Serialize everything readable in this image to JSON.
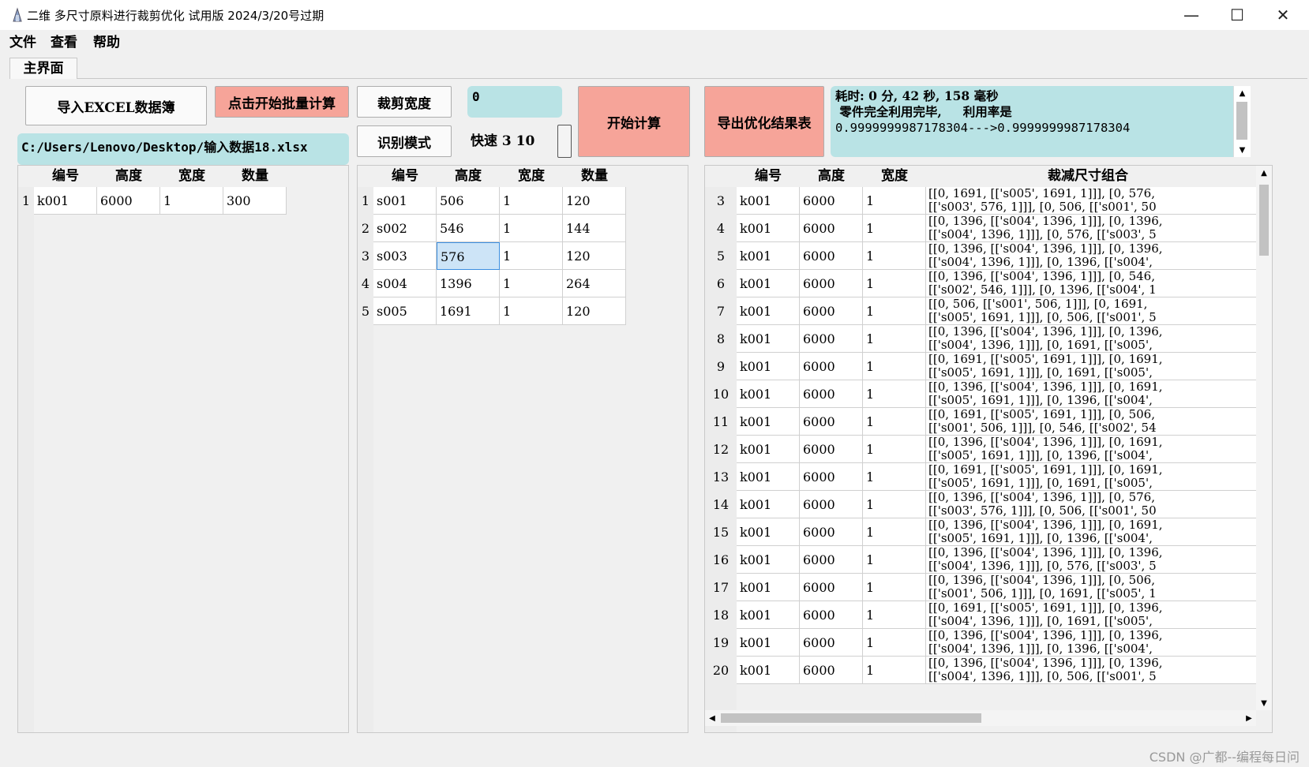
{
  "window": {
    "title": "二维 多尺寸原料进行裁剪优化 试用版 2024/3/20号过期",
    "minimize": "—",
    "maximize": "☐",
    "close": "✕"
  },
  "menu": [
    "文件",
    "查看",
    "帮助"
  ],
  "tab": "主界面",
  "buttons": {
    "import_excel": "导入EXCEL数据簿",
    "batch_calc": "点击开始批量计算",
    "cut_width": "裁剪宽度",
    "recognize_mode": "识别模式",
    "start_calc": "开始计算",
    "export_result": "导出优化结果表"
  },
  "counter_value": "0",
  "speed_text": "快速 3 10",
  "file_path": "C:/Users/Lenovo/Desktop/输入数据18.xlsx",
  "status_text": {
    "line1": "耗时: 0 分, 42 秒, 158 毫秒",
    "line2": " 零件完全利用完毕,     利用率是",
    "line3": "0.9999999987178304--->0.9999999987178304"
  },
  "raw_table": {
    "headers": [
      "编号",
      "高度",
      "宽度",
      "数量"
    ],
    "rows": [
      {
        "num": "1",
        "cells": [
          "k001",
          "6000",
          "1",
          "300"
        ]
      }
    ]
  },
  "parts_table": {
    "headers": [
      "编号",
      "高度",
      "宽度",
      "数量"
    ],
    "rows": [
      {
        "num": "1",
        "cells": [
          "s001",
          "506",
          "1",
          "120"
        ]
      },
      {
        "num": "2",
        "cells": [
          "s002",
          "546",
          "1",
          "144"
        ]
      },
      {
        "num": "3",
        "cells": [
          "s003",
          "576",
          "1",
          "120"
        ]
      },
      {
        "num": "4",
        "cells": [
          "s004",
          "1396",
          "1",
          "264"
        ]
      },
      {
        "num": "5",
        "cells": [
          "s005",
          "1691",
          "1",
          "120"
        ]
      }
    ]
  },
  "result_table": {
    "headers": [
      "编号",
      "高度",
      "宽度",
      "裁减尺寸组合"
    ],
    "rows": [
      {
        "num": "3",
        "cells": [
          "k001",
          "6000",
          "1"
        ],
        "combo": "[[0, 1691, [['s005', 1691, 1]]], [0, 576,\n[['s003', 576, 1]]], [0, 506, [['s001', 50"
      },
      {
        "num": "4",
        "cells": [
          "k001",
          "6000",
          "1"
        ],
        "combo": "[[0, 1396, [['s004', 1396, 1]]], [0, 1396,\n[['s004', 1396, 1]]], [0, 576, [['s003', 5"
      },
      {
        "num": "5",
        "cells": [
          "k001",
          "6000",
          "1"
        ],
        "combo": "[[0, 1396, [['s004', 1396, 1]]], [0, 1396,\n[['s004', 1396, 1]]], [0, 1396, [['s004',"
      },
      {
        "num": "6",
        "cells": [
          "k001",
          "6000",
          "1"
        ],
        "combo": "[[0, 1396, [['s004', 1396, 1]]], [0, 546,\n[['s002', 546, 1]]], [0, 1396, [['s004', 1"
      },
      {
        "num": "7",
        "cells": [
          "k001",
          "6000",
          "1"
        ],
        "combo": "[[0, 506, [['s001', 506, 1]]], [0, 1691,\n[['s005', 1691, 1]]], [0, 506, [['s001', 5"
      },
      {
        "num": "8",
        "cells": [
          "k001",
          "6000",
          "1"
        ],
        "combo": "[[0, 1396, [['s004', 1396, 1]]], [0, 1396,\n[['s004', 1396, 1]]], [0, 1691, [['s005',"
      },
      {
        "num": "9",
        "cells": [
          "k001",
          "6000",
          "1"
        ],
        "combo": "[[0, 1691, [['s005', 1691, 1]]], [0, 1691,\n[['s005', 1691, 1]]], [0, 1691, [['s005',"
      },
      {
        "num": "10",
        "cells": [
          "k001",
          "6000",
          "1"
        ],
        "combo": "[[0, 1396, [['s004', 1396, 1]]], [0, 1691,\n[['s005', 1691, 1]]], [0, 1396, [['s004',"
      },
      {
        "num": "11",
        "cells": [
          "k001",
          "6000",
          "1"
        ],
        "combo": "[[0, 1691, [['s005', 1691, 1]]], [0, 506,\n[['s001', 506, 1]]], [0, 546, [['s002', 54"
      },
      {
        "num": "12",
        "cells": [
          "k001",
          "6000",
          "1"
        ],
        "combo": "[[0, 1396, [['s004', 1396, 1]]], [0, 1691,\n[['s005', 1691, 1]]], [0, 1396, [['s004',"
      },
      {
        "num": "13",
        "cells": [
          "k001",
          "6000",
          "1"
        ],
        "combo": "[[0, 1691, [['s005', 1691, 1]]], [0, 1691,\n[['s005', 1691, 1]]], [0, 1691, [['s005',"
      },
      {
        "num": "14",
        "cells": [
          "k001",
          "6000",
          "1"
        ],
        "combo": "[[0, 1396, [['s004', 1396, 1]]], [0, 576,\n[['s003', 576, 1]]], [0, 506, [['s001', 50"
      },
      {
        "num": "15",
        "cells": [
          "k001",
          "6000",
          "1"
        ],
        "combo": "[[0, 1396, [['s004', 1396, 1]]], [0, 1691,\n[['s005', 1691, 1]]], [0, 1396, [['s004',"
      },
      {
        "num": "16",
        "cells": [
          "k001",
          "6000",
          "1"
        ],
        "combo": "[[0, 1396, [['s004', 1396, 1]]], [0, 1396,\n[['s004', 1396, 1]]], [0, 576, [['s003', 5"
      },
      {
        "num": "17",
        "cells": [
          "k001",
          "6000",
          "1"
        ],
        "combo": "[[0, 1396, [['s004', 1396, 1]]], [0, 506,\n[['s001', 506, 1]]], [0, 1691, [['s005', 1"
      },
      {
        "num": "18",
        "cells": [
          "k001",
          "6000",
          "1"
        ],
        "combo": "[[0, 1691, [['s005', 1691, 1]]], [0, 1396,\n[['s004', 1396, 1]]], [0, 1691, [['s005',"
      },
      {
        "num": "19",
        "cells": [
          "k001",
          "6000",
          "1"
        ],
        "combo": "[[0, 1396, [['s004', 1396, 1]]], [0, 1396,\n[['s004', 1396, 1]]], [0, 1396, [['s004',"
      },
      {
        "num": "20",
        "cells": [
          "k001",
          "6000",
          "1"
        ],
        "combo": "[[0, 1396, [['s004', 1396, 1]]], [0, 1396,\n[['s004', 1396, 1]]], [0, 506, [['s001', 5"
      }
    ]
  },
  "scroll_arrows": {
    "up": "▲",
    "down": "▼",
    "left": "◀",
    "right": "▶"
  },
  "watermark": "CSDN @广都--编程每日问"
}
